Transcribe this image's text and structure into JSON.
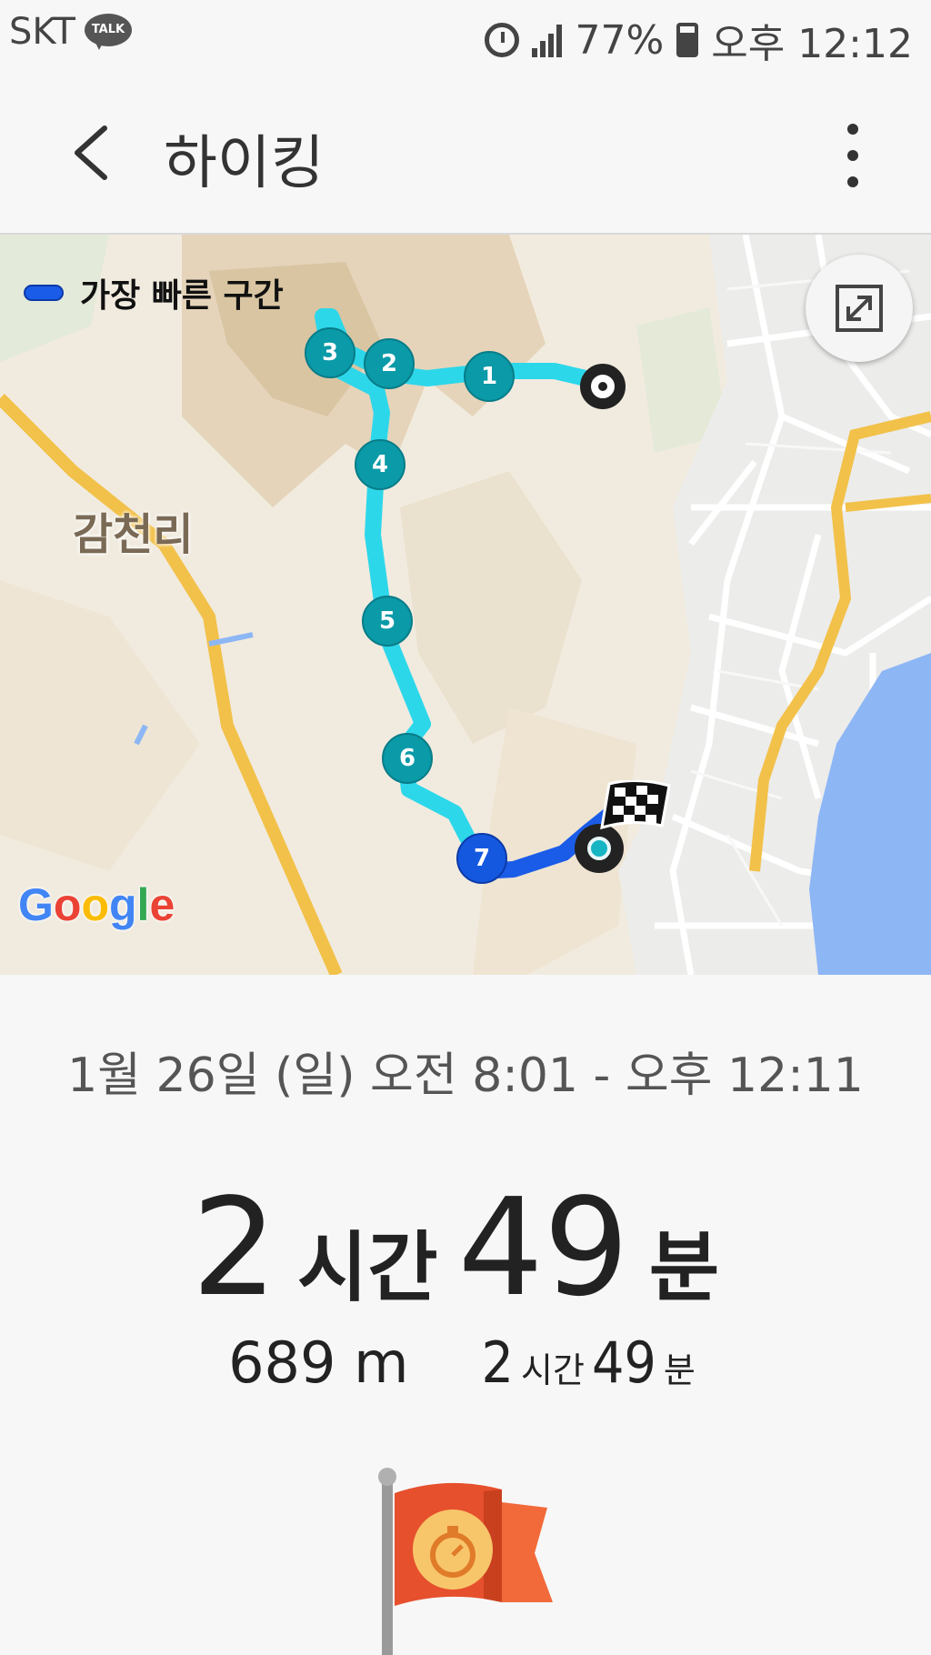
{
  "status_bar": {
    "carrier": "SKT",
    "talk_label": "TALK",
    "battery": "77%",
    "time": "오후 12:12"
  },
  "app_bar": {
    "title": "하이킹"
  },
  "map": {
    "legend_label": "가장 빠른 구간",
    "place_label": "감천리",
    "google_logo": [
      "G",
      "o",
      "o",
      "g",
      "l",
      "e"
    ],
    "google_colors": [
      "#4285F4",
      "#EA4335",
      "#FBBC05",
      "#4285F4",
      "#34A853",
      "#EA4335"
    ],
    "waypoints": [
      "1",
      "2",
      "3",
      "4",
      "5",
      "6",
      "7"
    ],
    "route_color": "#1fd2e6",
    "fastest_color": "#1a5ce8"
  },
  "details": {
    "date_range": "1월 26일 (일) 오전 8:01 - 오후 12:11",
    "duration": {
      "hours": "2",
      "hours_unit": "시간",
      "minutes": "49",
      "minutes_unit": "분"
    },
    "distance": "689 m",
    "stat_duration": {
      "hours": "2",
      "hours_unit": "시간",
      "minutes": "49",
      "minutes_unit": "분"
    }
  }
}
